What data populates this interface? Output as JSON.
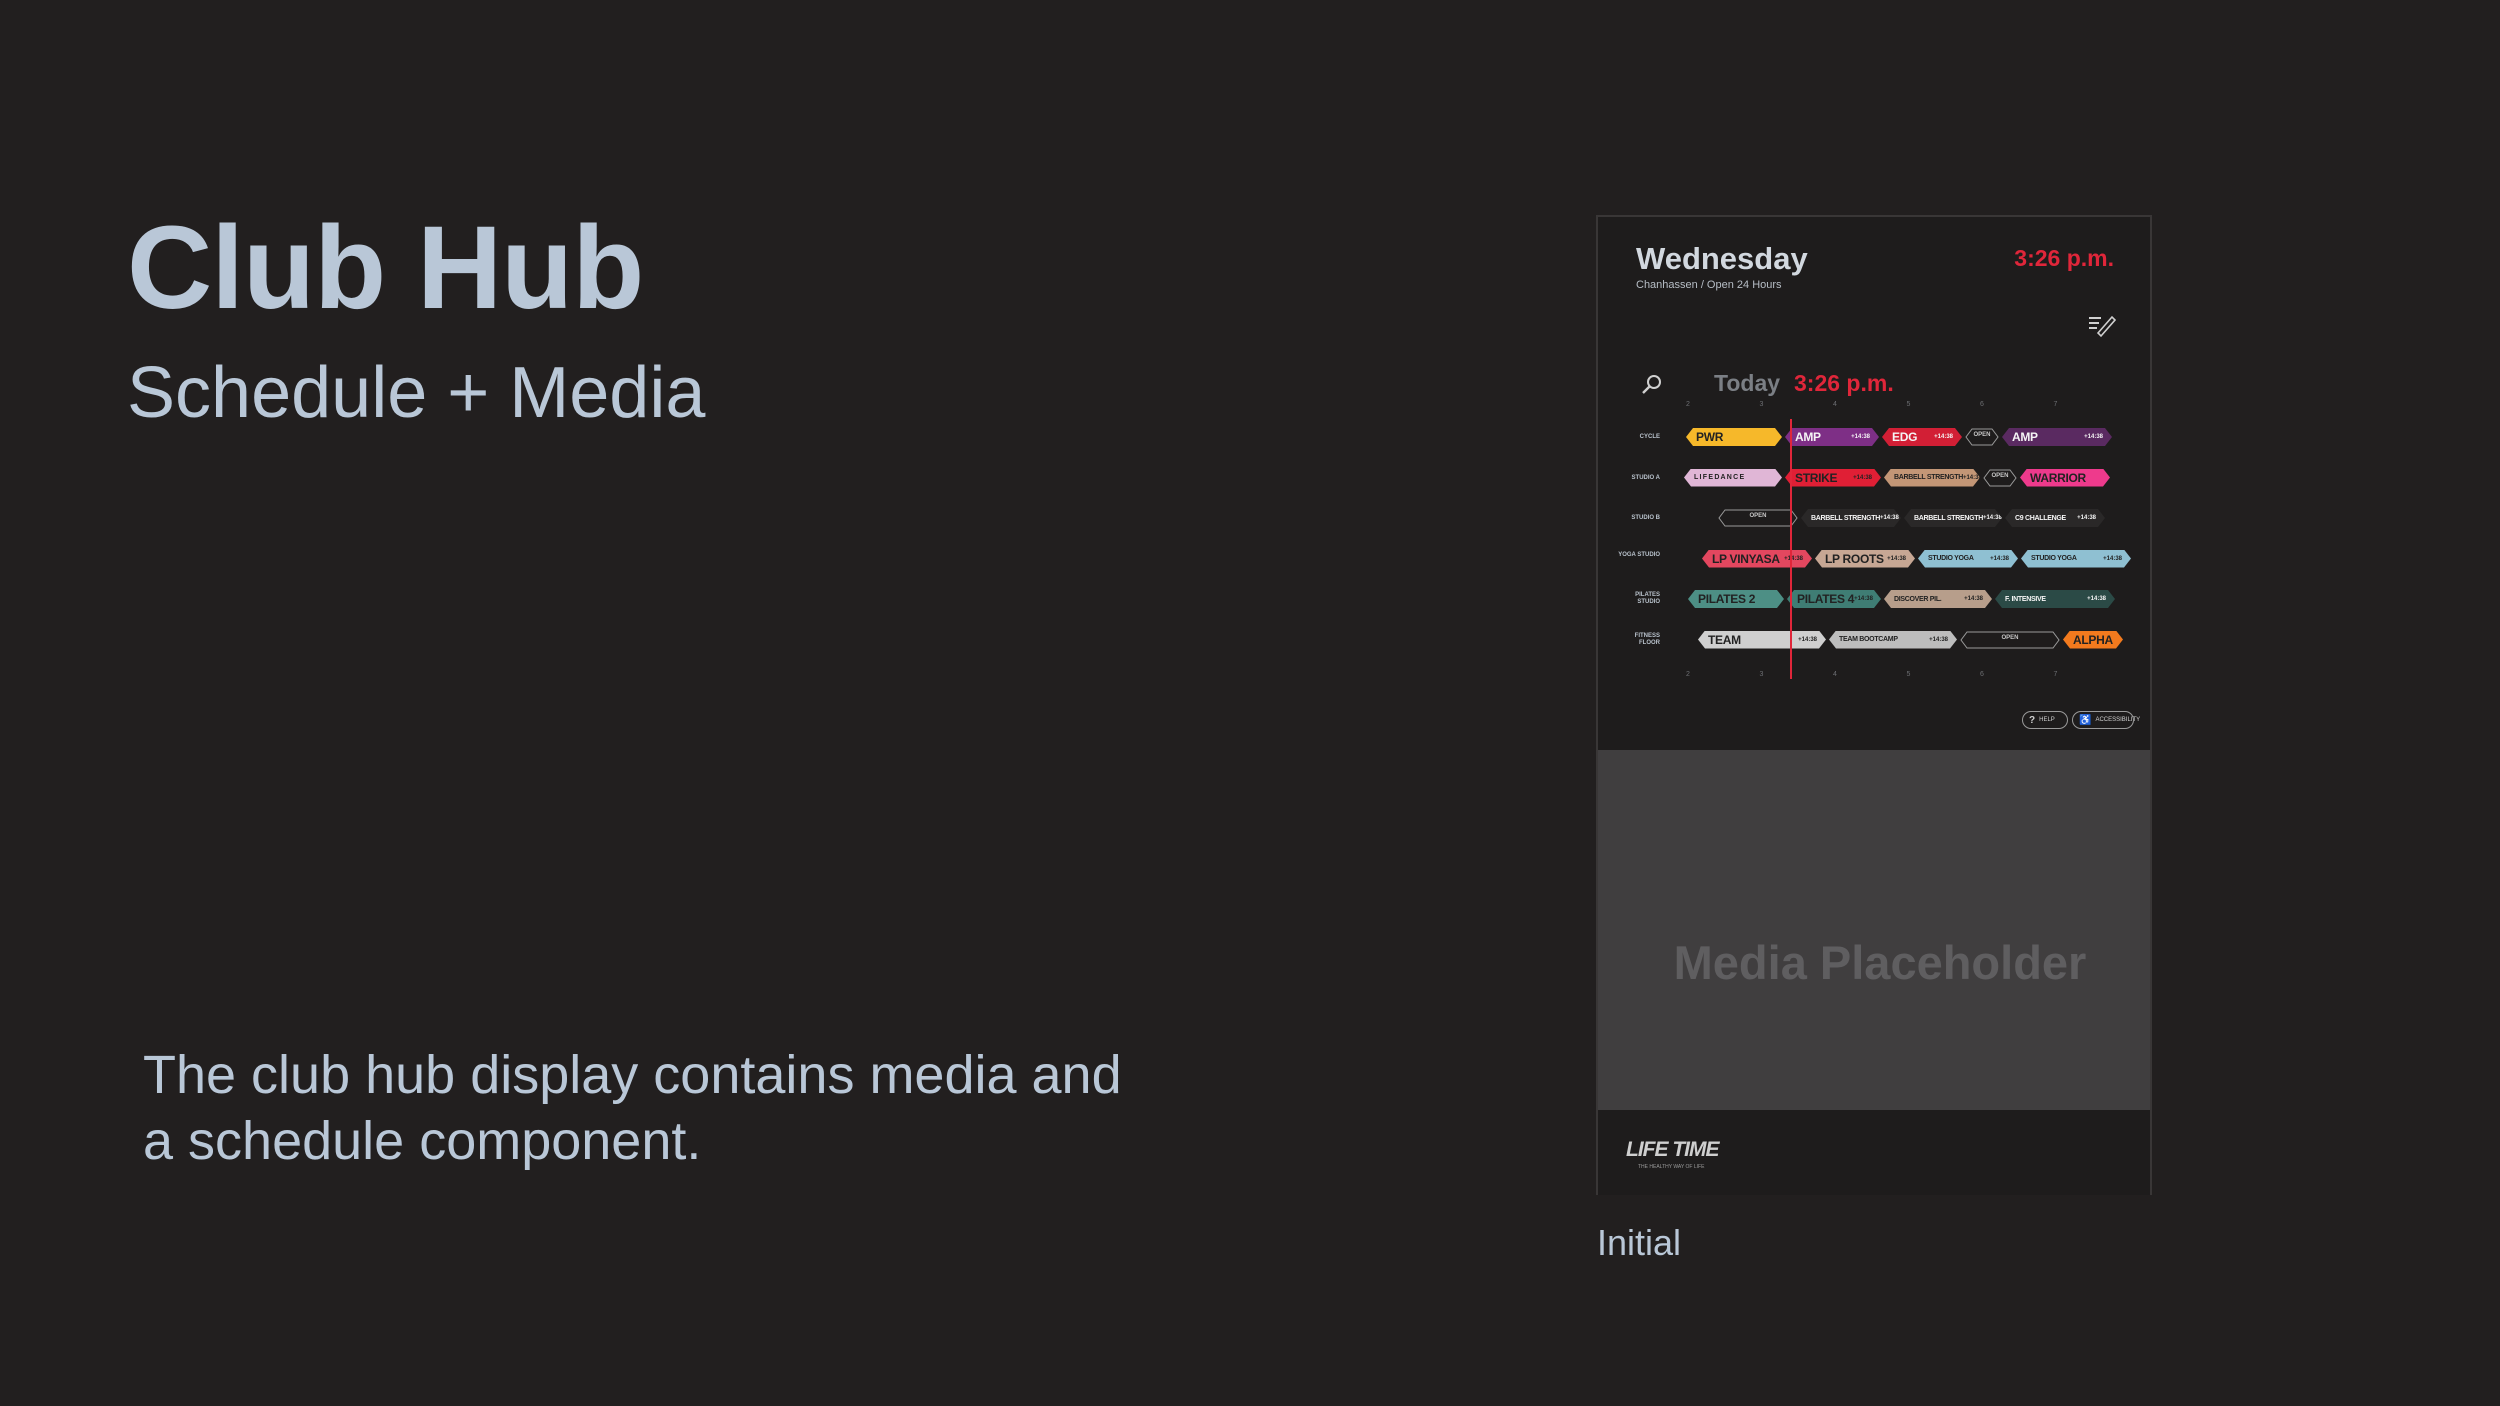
{
  "slide": {
    "title": "Club Hub",
    "subtitle": "Schedule + Media",
    "body": "The club hub display contains media and a schedule component.",
    "caption": "Initial"
  },
  "display": {
    "day": "Wednesday",
    "location": "Chanhassen / Open 24 Hours",
    "time": "3:26 p.m.",
    "today_label": "Today",
    "today_time": "3:26 p.m.",
    "hour_ticks": [
      "2",
      "3",
      "4",
      "5",
      "6",
      "7"
    ],
    "rooms": [
      {
        "name": "CYCLE",
        "classes": [
          {
            "label": "PWR",
            "time": "",
            "color": "#f6b82a",
            "light": false
          },
          {
            "label": "AMP",
            "time": "+14:38",
            "color": "#7e2f86",
            "light": true
          },
          {
            "label": "EDG",
            "time": "+14:38",
            "color": "#d21f35",
            "light": true
          },
          {
            "label": "OPEN",
            "open": true
          },
          {
            "label": "AMP",
            "time": "+14:38",
            "color": "#5a2a61",
            "light": true
          }
        ]
      },
      {
        "name": "STUDIO A",
        "classes": [
          {
            "label": "L I F E  D A N C E",
            "time": "",
            "color": "#e0b6d6",
            "light": false
          },
          {
            "label": "STRIKE",
            "time": "+14:38",
            "color": "#e01f35",
            "light": false
          },
          {
            "label": "BARBELL STRENGTH",
            "time": "+14:38",
            "color": "#c39676",
            "light": false
          },
          {
            "label": "OPEN",
            "open": true
          },
          {
            "label": "WARRIOR",
            "time": "",
            "color": "#ee3a8c",
            "light": false
          }
        ]
      },
      {
        "name": "STUDIO B",
        "classes": [
          {
            "label": "OPEN",
            "open": true
          },
          {
            "label": "BARBELL STRENGTH",
            "time": "+14:38",
            "color": "#2a2828",
            "light": true
          },
          {
            "label": "BARBELL STRENGTH",
            "time": "+14:38",
            "color": "#2a2828",
            "light": true
          },
          {
            "label": "C9 CHALLENGE",
            "time": "+14:38",
            "color": "#2a2828",
            "light": true
          }
        ]
      },
      {
        "name": "YOGA STUDIO",
        "classes": [
          {
            "label": "LP VINYASA",
            "time": "+14:38",
            "color": "#e3475f",
            "light": false
          },
          {
            "label": "LP ROOTS",
            "time": "+14:38",
            "color": "#c7a794",
            "light": false
          },
          {
            "label": "STUDIO YOGA",
            "time": "+14:38",
            "color": "#8fc0d2",
            "light": false
          },
          {
            "label": "STUDIO YOGA",
            "time": "+14:38",
            "color": "#8fc0d2",
            "light": false
          }
        ]
      },
      {
        "name": "PILATES STUDIO",
        "classes": [
          {
            "label": "PILATES 2",
            "time": "",
            "color": "#4d8f85",
            "light": false
          },
          {
            "label": "PILATES 4",
            "time": "+14:38",
            "color": "#3f7d74",
            "light": false
          },
          {
            "label": "DISCOVER PIL.",
            "time": "+14:38",
            "color": "#b79e8b",
            "light": false
          },
          {
            "label": "F. INTENSIVE",
            "time": "+14:38",
            "color": "#2b4a46",
            "light": true
          }
        ]
      },
      {
        "name": "FITNESS FLOOR",
        "classes": [
          {
            "label": "TEAM",
            "time": "+14:38",
            "color": "#cfcfcf",
            "light": false
          },
          {
            "label": "TEAM BOOTCAMP",
            "time": "+14:38",
            "color": "#bdbdbd",
            "light": false
          },
          {
            "label": "OPEN",
            "open": true
          },
          {
            "label": "ALPHA",
            "time": "",
            "color": "#f27a1e",
            "light": false
          }
        ]
      }
    ],
    "help_label": "HELP",
    "accessibility_label": "ACCESSIBILITY",
    "media_placeholder": "Media Placeholder",
    "brand": "LIFE TIME",
    "tagline": "THE HEALTHY WAY OF LIFE"
  }
}
